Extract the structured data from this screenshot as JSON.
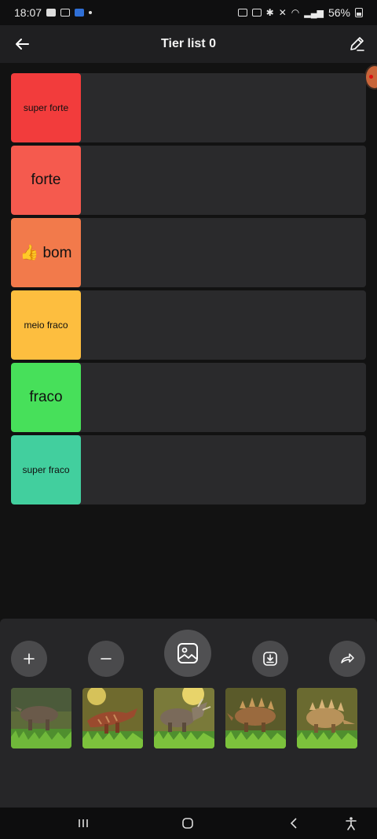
{
  "status_bar": {
    "time": "18:07",
    "battery": "56%"
  },
  "app_bar": {
    "title": "Tier list 0"
  },
  "tiers": [
    {
      "label": "super forte",
      "color": "#f23c3c",
      "size": "small"
    },
    {
      "label": "forte",
      "color": "#f55a4e",
      "size": "large"
    },
    {
      "label": "👍 bom",
      "color": "#f27a4b",
      "size": "large"
    },
    {
      "label": "meio fraco",
      "color": "#fdbe3f",
      "size": "small"
    },
    {
      "label": "fraco",
      "color": "#47e05a",
      "size": "large"
    },
    {
      "label": "super fraco",
      "color": "#42cf9e",
      "size": "small"
    }
  ],
  "toolbar": {
    "icons": [
      "plus-icon",
      "minus-icon",
      "image-icon",
      "download-icon",
      "share-icon"
    ]
  },
  "thumbnails": [
    "dinosaur-thumbnail",
    "dinosaur-thumbnail",
    "dinosaur-thumbnail",
    "dinosaur-thumbnail",
    "dinosaur-thumbnail"
  ]
}
